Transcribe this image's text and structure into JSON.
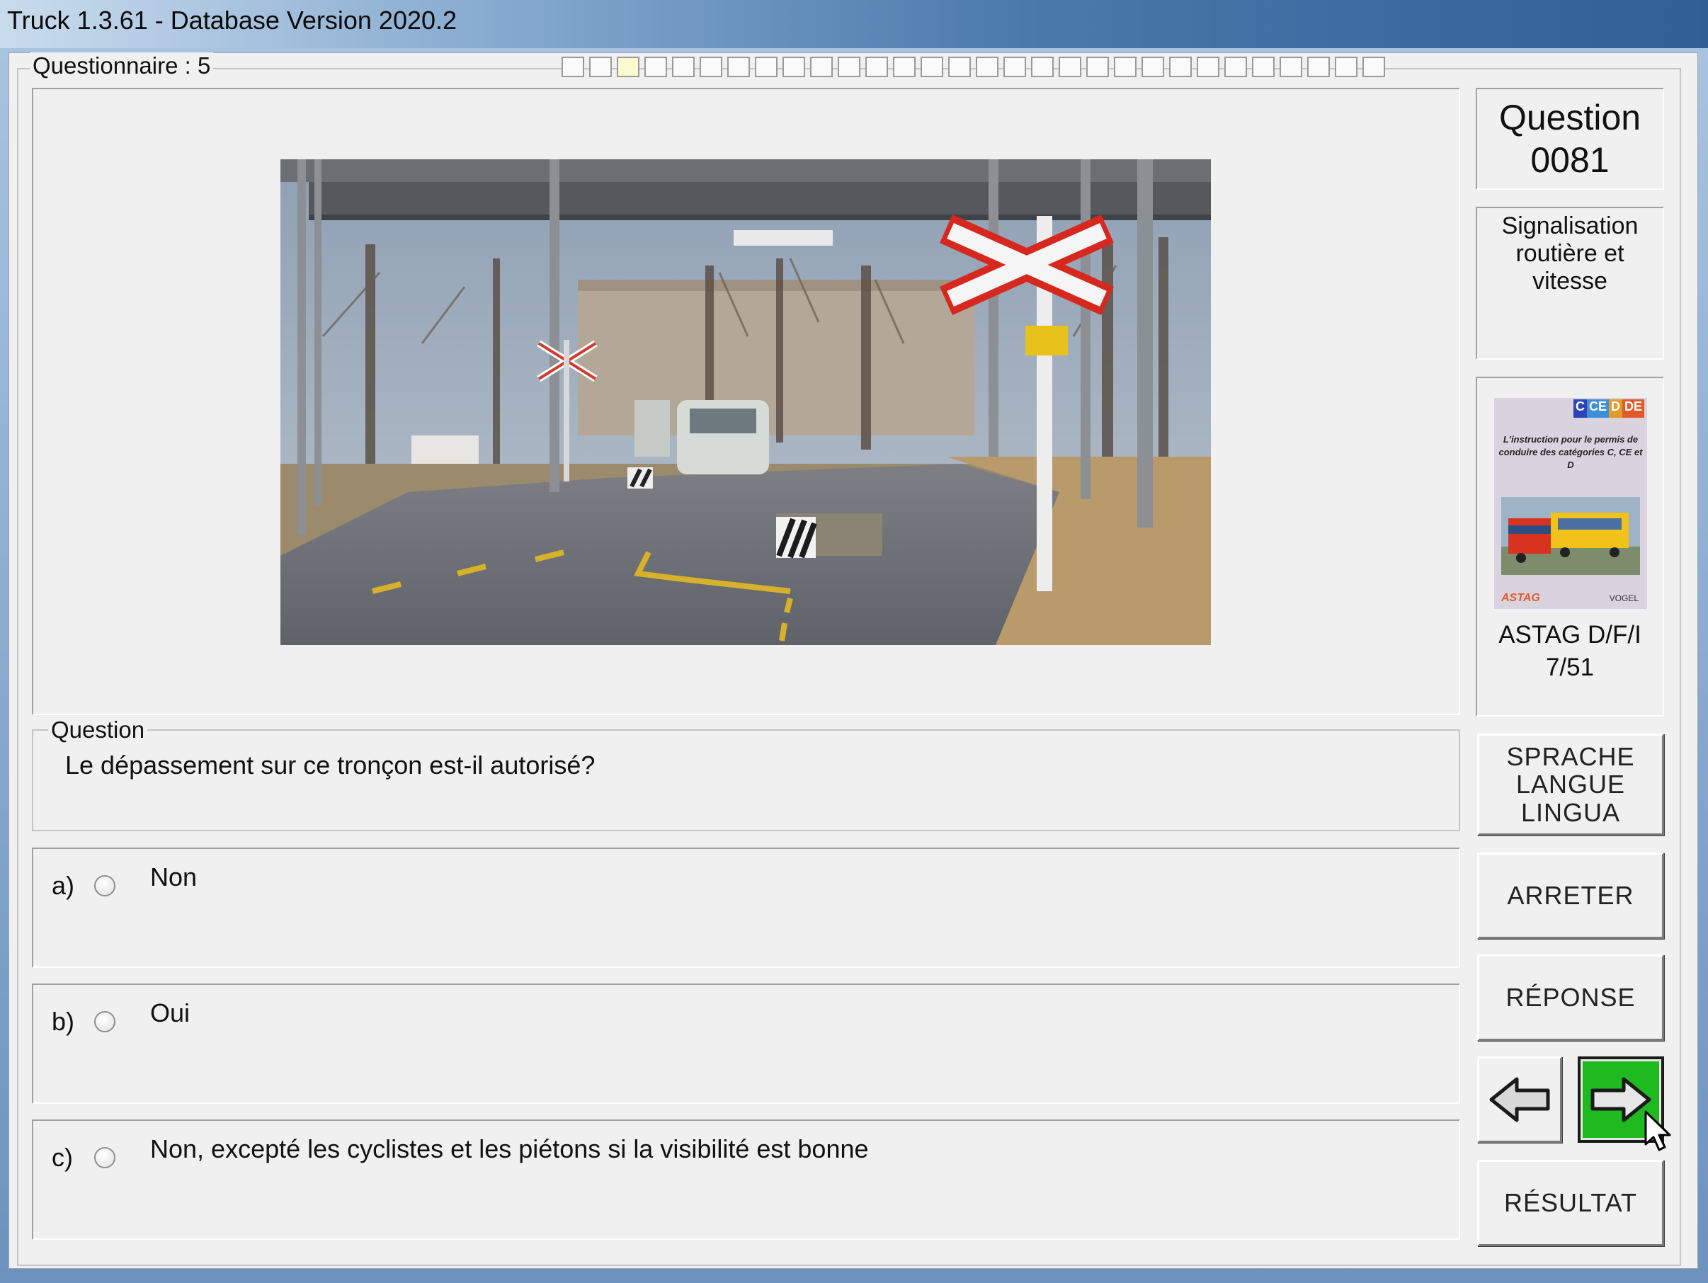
{
  "window": {
    "title": "Truck 1.3.61 - Database Version 2020.2"
  },
  "questionnaire": {
    "label": "Questionnaire : 5",
    "progress_total": 30,
    "progress_current_index": 2
  },
  "question_panel": {
    "header_line1": "Question",
    "header_line2": "0081",
    "category": "Signalisation routière et vitesse",
    "book": {
      "badge": "C CE D DE",
      "cover_text": "L'instruction pour le permis de conduire des catégories C, CE et D",
      "reference_line1": "ASTAG D/F/I",
      "reference_line2": "7/51"
    }
  },
  "question": {
    "legend": "Question",
    "text": "Le dépassement sur ce tronçon est-il autorisé?"
  },
  "answers": [
    {
      "letter": "a)",
      "text": "Non"
    },
    {
      "letter": "b)",
      "text": "Oui"
    },
    {
      "letter": "c)",
      "text": "Non, excepté les cyclistes et les piétons si la visibilité est bonne"
    }
  ],
  "buttons": {
    "language": "SPRACHE LANGUE LINGUA",
    "stop": "ARRETER",
    "answer": "RÉPONSE",
    "result": "RÉSULTAT"
  },
  "colors": {
    "next_button": "#1fba1f",
    "current_progress_cell": "#fbfbd2"
  },
  "icons": {
    "prev": "arrow-left-icon",
    "next": "arrow-right-icon"
  }
}
